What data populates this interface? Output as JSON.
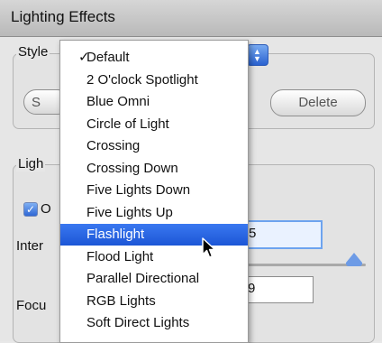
{
  "window": {
    "title": "Lighting Effects"
  },
  "style_group": {
    "label": "Style",
    "delete_label": "Delete",
    "save_label": "S"
  },
  "lights_group": {
    "label": "Ligh",
    "on_label": "O",
    "intensity_label": "Inter",
    "intensity_value": "5",
    "focus_label": "Focu",
    "focus_value": "9"
  },
  "style_menu": {
    "checkmark": "✓",
    "selected": "Default",
    "highlighted": "Flashlight",
    "items": [
      "Default",
      "2 O'clock Spotlight",
      "Blue Omni",
      "Circle of Light",
      "Crossing",
      "Crossing Down",
      "Five Lights Down",
      "Five Lights Up",
      "Flashlight",
      "Flood Light",
      "Parallel Directional",
      "RGB Lights",
      "Soft Direct Lights"
    ]
  },
  "colors": {
    "accent": "#2a62d0",
    "highlight": "#1c56d6"
  },
  "icons": {
    "checkbox": "checkbox-checked-icon",
    "popup": "popup-arrows-icon",
    "cursor": "pointer-cursor-icon"
  }
}
